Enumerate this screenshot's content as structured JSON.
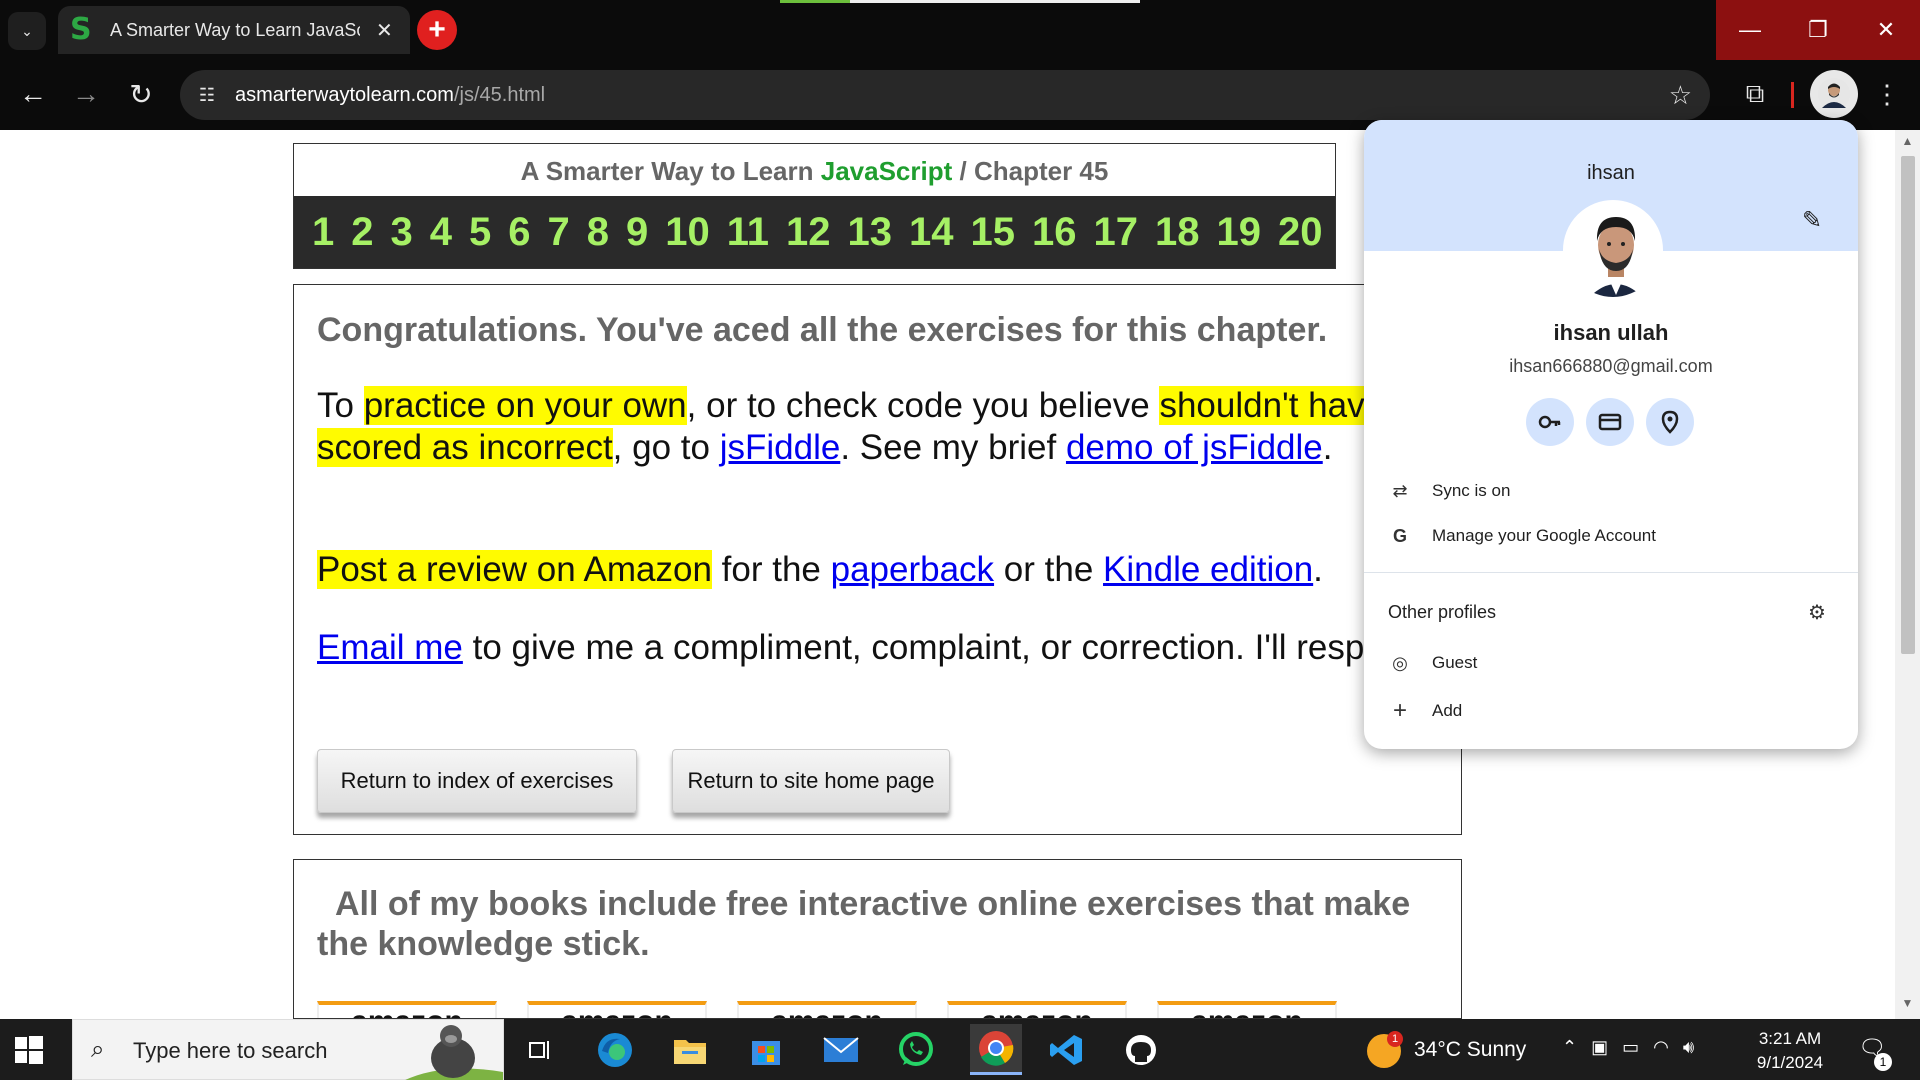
{
  "browser": {
    "tab_title": "A Smarter Way to Learn JavaScr",
    "favicon_letter": "S",
    "url_host": "asmarterwaytolearn.com",
    "url_path": "/js/45.html"
  },
  "page": {
    "header_prefix": "A Smarter Way to Learn",
    "header_js": "JavaScript",
    "header_suffix": "/  Chapter 45",
    "chapters": [
      "1",
      "2",
      "3",
      "4",
      "5",
      "6",
      "7",
      "8",
      "9",
      "10",
      "11",
      "12",
      "13",
      "14",
      "15",
      "16",
      "17",
      "18",
      "19",
      "20"
    ],
    "congrats": "Congratulations. You've aced all the exercises for this chapter.",
    "p1_a": "To ",
    "p1_hl1": "practice on your own",
    "p1_b": ", or to check code you believe ",
    "p1_hl2": "shouldn't have been scored as incorrect",
    "p1_c": ", go to ",
    "p1_link1": "jsFiddle",
    "p1_d": ". See my brief ",
    "p1_link2": "demo of jsFiddle",
    "p1_e": ".",
    "p2_hl": "Post a review on Amazon",
    "p2_a": " for the ",
    "p2_link1": "paperback",
    "p2_b": " or the ",
    "p2_link2": "Kindle edition",
    "p2_c": ".",
    "p3_link": "Email me",
    "p3_a": " to give me a compliment, complaint, or correction. I'll respond.",
    "btn_index": "Return to index of exercises",
    "btn_home": "Return to site home page",
    "books_text": "All of my books include free interactive online exercises that make the knowledge stick.",
    "amazon_label": "amazon"
  },
  "profile": {
    "short_name": "ihsan",
    "full_name": "ihsan ullah",
    "email": "ihsan666880@gmail.com",
    "sync": "Sync is on",
    "manage": "Manage your Google Account",
    "other_profiles": "Other profiles",
    "guest": "Guest",
    "add": "Add"
  },
  "taskbar": {
    "search_placeholder": "Type here to search",
    "weather": "34°C  Sunny",
    "weather_badge": "1",
    "time": "3:21 AM",
    "date": "9/1/2024",
    "notification_count": "1"
  }
}
